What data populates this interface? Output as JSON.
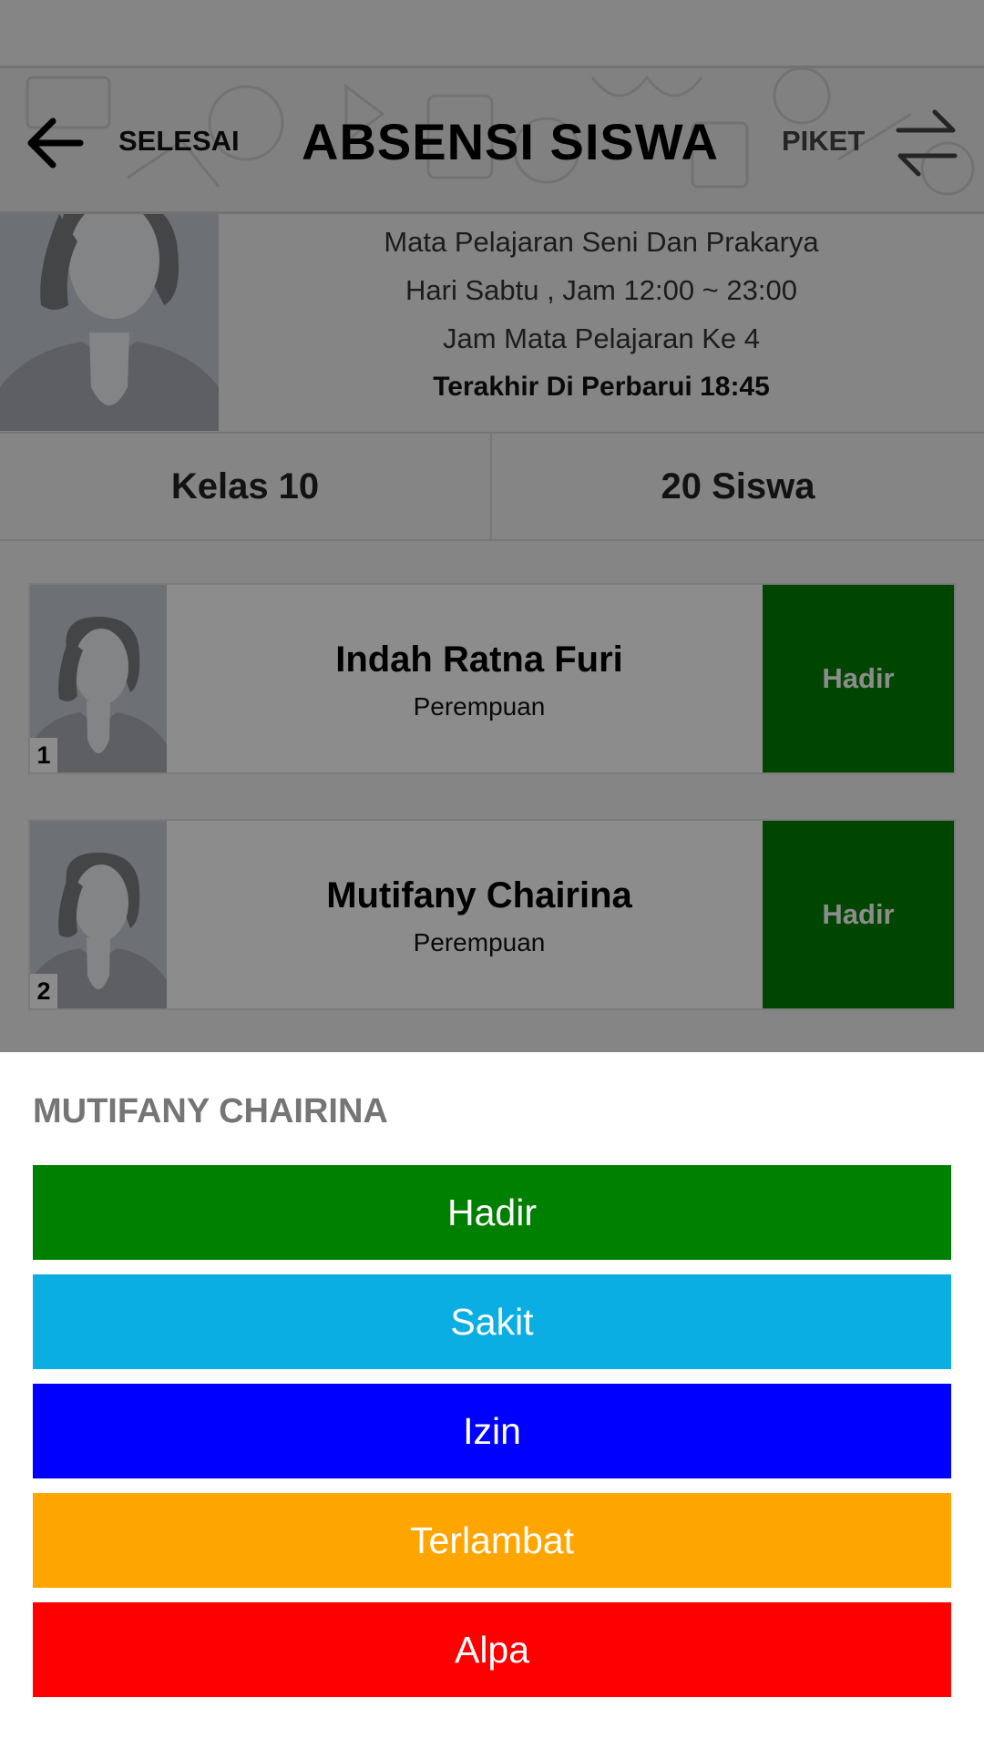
{
  "header": {
    "back_label": "SELESAI",
    "title": "ABSENSI SISWA",
    "piket_label": "PIKET"
  },
  "subject_info": {
    "line1": "Mata Pelajaran Seni Dan Prakarya",
    "line2": "Hari Sabtu , Jam 12:00 ~ 23:00",
    "line3": "Jam Mata Pelajaran Ke 4",
    "updated": "Terakhir Di Perbarui 18:45"
  },
  "stats": {
    "class_label": "Kelas 10",
    "students_label": "20 Siswa"
  },
  "students": [
    {
      "number": "1",
      "name": "Indah Ratna Furi",
      "gender": "Perempuan",
      "status": "Hadir"
    },
    {
      "number": "2",
      "name": "Mutifany Chairina",
      "gender": "Perempuan",
      "status": "Hadir"
    }
  ],
  "dialog": {
    "title": "MUTIFANY CHAIRINA",
    "options": [
      {
        "label": "Hadir",
        "color": "#008000"
      },
      {
        "label": "Sakit",
        "color": "#0AAEE3"
      },
      {
        "label": "Izin",
        "color": "#0000FF"
      },
      {
        "label": "Terlambat",
        "color": "#FFA500"
      },
      {
        "label": "Alpa",
        "color": "#FF0000"
      }
    ]
  },
  "colors": {
    "status_hadir": "#008000",
    "sheet_title": "#757575"
  }
}
